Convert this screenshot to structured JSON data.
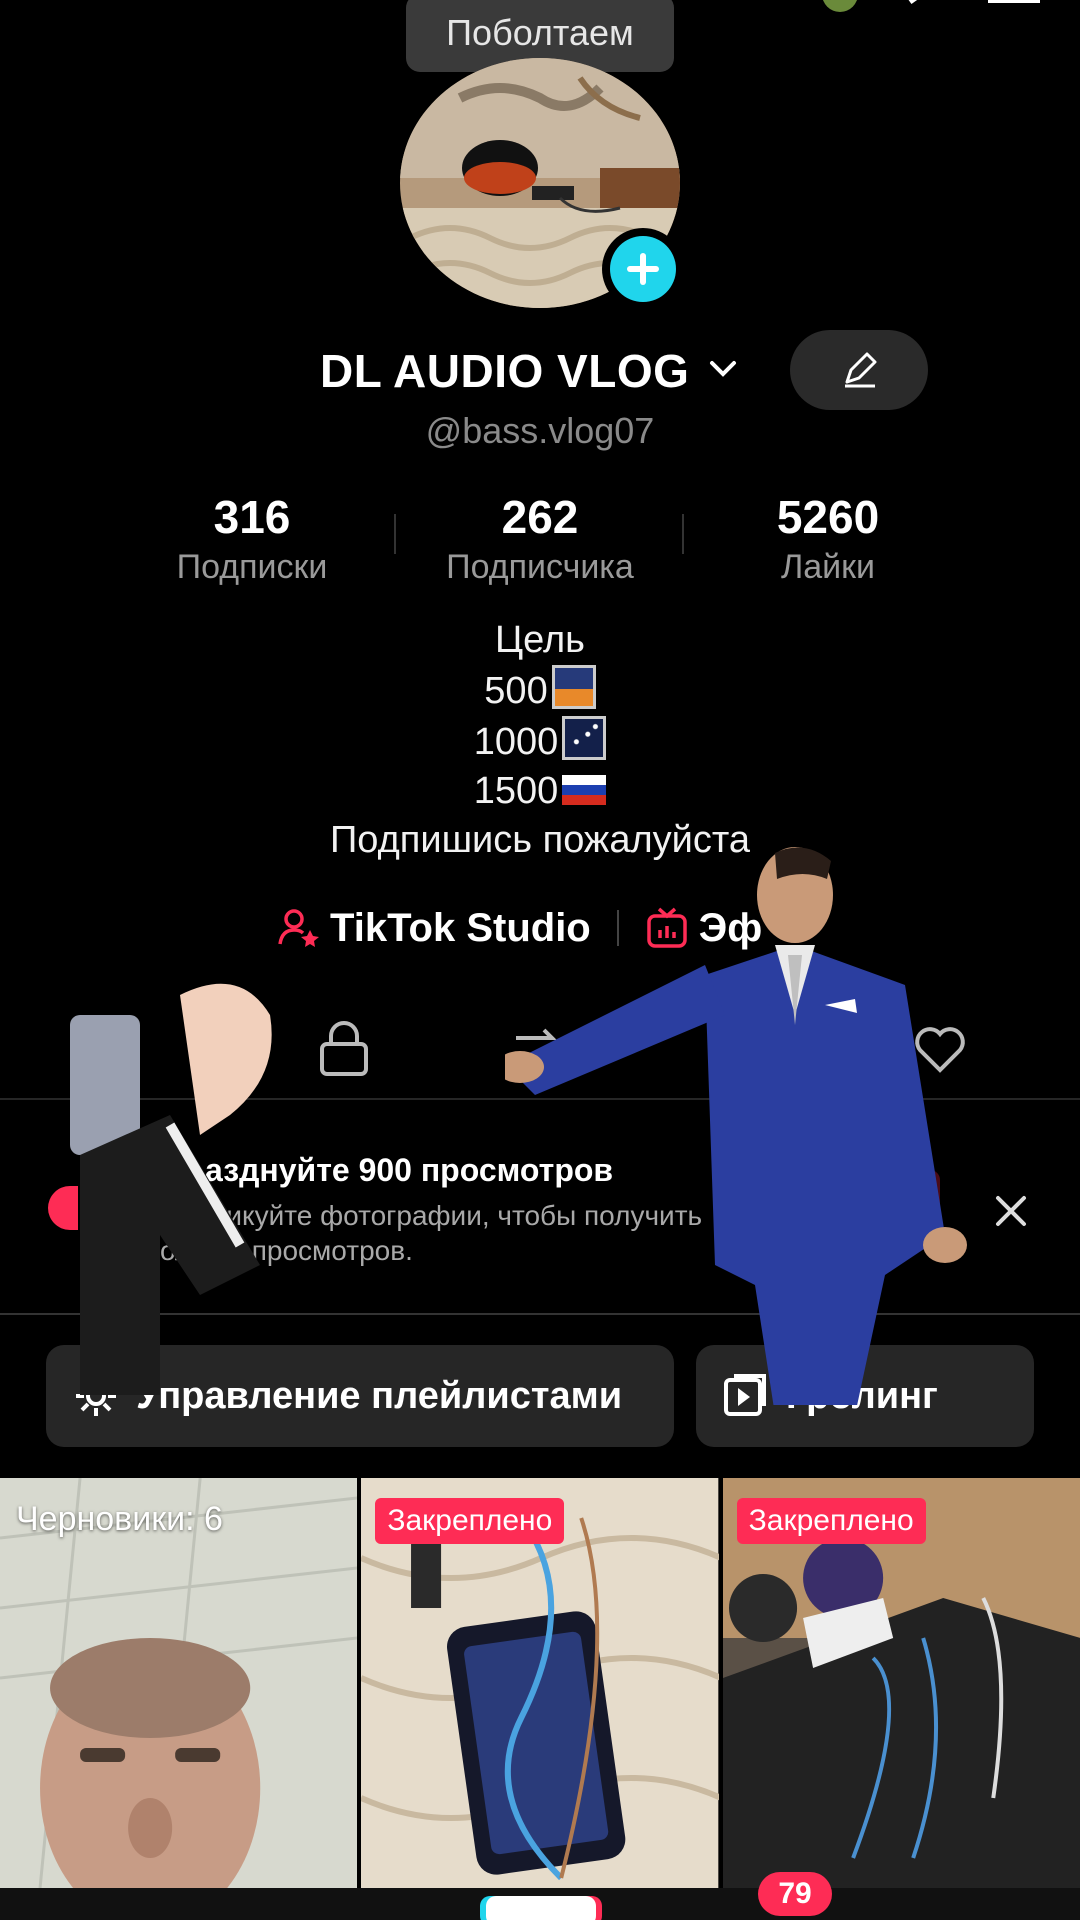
{
  "tooltip": {
    "text": "Поболтаем"
  },
  "profile": {
    "display_name": "DL AUDIO VLOG",
    "handle": "@bass.vlog07"
  },
  "stats": [
    {
      "value": "316",
      "label": "Подписки"
    },
    {
      "value": "262",
      "label": "Подписчика"
    },
    {
      "value": "5260",
      "label": "Лайки"
    }
  ],
  "bio": {
    "line1": "Цель",
    "line2": "500",
    "line3": "1000",
    "line4": "1500",
    "line5": "Подпишись пожалуйста"
  },
  "links": {
    "studio": "TikTok Studio",
    "second": "Эф"
  },
  "banner": {
    "title": "азднуйте 900 просмотров",
    "subtitle": "Опубликуйте фотографии, чтобы получить больше просмотров.",
    "action": "ать"
  },
  "playlists": {
    "manage": "Управление плейлистами",
    "troll": "Гролинг"
  },
  "grid": {
    "drafts": "Черновики: 6",
    "pinned_1": "Закреплено",
    "pinned_2": "Закреплено"
  },
  "nav": {
    "inbox_badge": "79"
  },
  "colors": {
    "accent": "#fe2c55",
    "teal": "#20d5ec",
    "background": "#000000"
  },
  "icons": [
    "pencil-icon",
    "add-icon",
    "chevron-down-icon",
    "studio-user-icon",
    "tv-icon",
    "lock-icon",
    "repost-icon",
    "heart-icon",
    "close-icon",
    "gear-icon",
    "playlist-play-icon"
  ]
}
